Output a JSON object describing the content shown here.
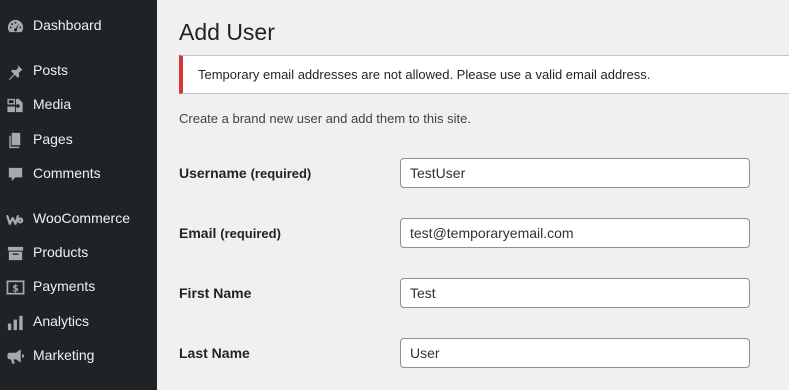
{
  "sidebar": {
    "items": [
      {
        "label": "Dashboard",
        "icon": "dashboard-icon"
      },
      {
        "label": "Posts",
        "icon": "pin-icon"
      },
      {
        "label": "Media",
        "icon": "media-icon"
      },
      {
        "label": "Pages",
        "icon": "pages-icon"
      },
      {
        "label": "Comments",
        "icon": "comment-icon"
      },
      {
        "label": "WooCommerce",
        "icon": "woocommerce-icon"
      },
      {
        "label": "Products",
        "icon": "archive-box-icon"
      },
      {
        "label": "Payments",
        "icon": "payments-icon"
      },
      {
        "label": "Analytics",
        "icon": "bar-chart-icon"
      },
      {
        "label": "Marketing",
        "icon": "megaphone-icon"
      }
    ]
  },
  "main": {
    "title": "Add User",
    "notice": "Temporary email addresses are not allowed. Please use a valid email address.",
    "intro": "Create a brand new user and add them to this site.",
    "fields": [
      {
        "label": "Username",
        "required_note": "(required)",
        "value": "TestUser"
      },
      {
        "label": "Email",
        "required_note": "(required)",
        "value": "test@temporaryemail.com"
      },
      {
        "label": "First Name",
        "required_note": "",
        "value": "Test"
      },
      {
        "label": "Last Name",
        "required_note": "",
        "value": "User"
      }
    ]
  },
  "colors": {
    "sidebar_bg": "#1d2327",
    "sidebar_text": "#f0f0f1",
    "icon_color": "#a7aaad",
    "page_bg": "#f0f0f1",
    "notice_error": "#d63638"
  }
}
